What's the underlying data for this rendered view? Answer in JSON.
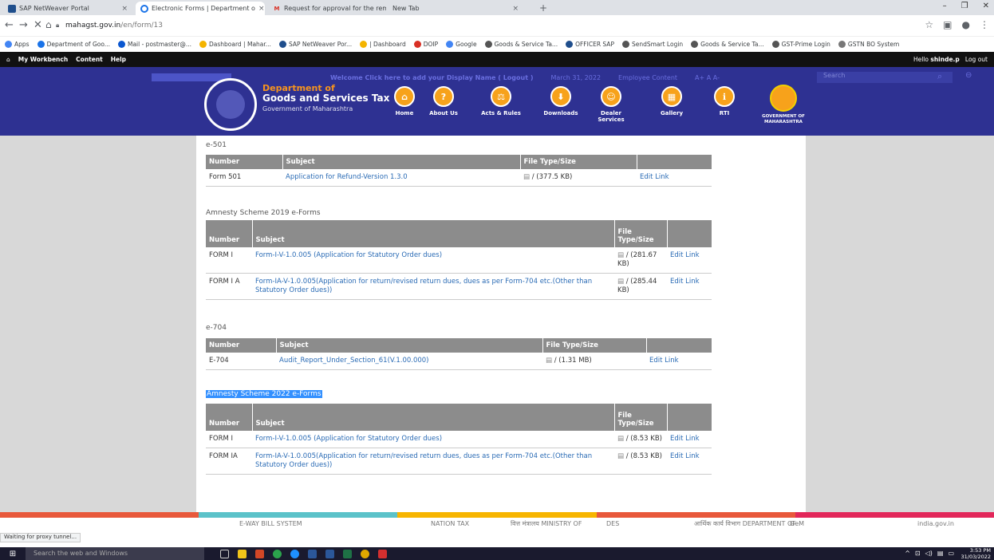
{
  "browser": {
    "tabs": [
      {
        "title": "SAP NetWeaver Portal",
        "color": "#1f4e8c",
        "active": false
      },
      {
        "title": "Electronic Forms | Department o",
        "color": "#1a73e8",
        "active": true
      },
      {
        "title": "Request for approval for the rem",
        "color": "#d93025",
        "active": false
      },
      {
        "title": "New Tab",
        "color": "#ffffff",
        "active": false
      }
    ],
    "url_host": "mahagst.gov.in",
    "url_path": "/en/form/13",
    "bookmarks": [
      "Apps",
      "Department of Goo...",
      "Mail - postmaster@...",
      "Dashboard | Mahar...",
      "SAP NetWeaver Por...",
      "| Dashboard",
      "DOIP",
      "Google",
      "Goods & Service Ta...",
      "OFFICER SAP",
      "SendSmart Login",
      "Goods & Service Ta...",
      "GST-Prime Login",
      "GSTN BO System"
    ]
  },
  "workbench": {
    "items": [
      "My Workbench",
      "Content",
      "Help"
    ],
    "hello_prefix": "Hello",
    "user": "shinde.p",
    "logout": "Log out"
  },
  "site": {
    "welcome_text": "Welcome  Click here  to add your Display Name ( Logout )",
    "date_text": "March 31, 2022",
    "employee_content": "Employee Content",
    "font_ctrl": "A+  A  A-",
    "search_label": "Search",
    "dept_line1": "Department of",
    "dept_line2": "Goods and Services Tax",
    "dept_line3": "Government of Maharashtra",
    "nav": [
      "Home",
      "About Us",
      "Acts & Rules",
      "Downloads",
      "Dealer Services",
      "Gallery",
      "RTI"
    ],
    "gom_line1": "GOVERNMENT OF",
    "gom_line2": "MAHARASHTRA",
    "accent": "#f7a21b",
    "header_bg": "#2e3192"
  },
  "sections": [
    {
      "title": "e-501",
      "headers": [
        "Number",
        "Subject",
        "File Type/Size",
        ""
      ],
      "rows": [
        {
          "number": "Form 501",
          "subject": "Application for Refund-Version 1.3.0",
          "file": "/ (377.5 KB)",
          "edit": "Edit Link"
        }
      ]
    },
    {
      "title": "Amnesty Scheme 2019 e-Forms",
      "headers": [
        "Number",
        "Subject",
        "File Type/Size",
        ""
      ],
      "rows": [
        {
          "number": "FORM I",
          "subject": "Form-I-V-1.0.005 (Application for Statutory Order dues)",
          "file": "/ (281.67 KB)",
          "edit": "Edit Link"
        },
        {
          "number": "FORM I A",
          "subject": "Form-IA-V-1.0.005(Application for return/revised return dues, dues as per Form-704 etc.(Other than Statutory Order dues))",
          "file": "/ (285.44 KB)",
          "edit": "Edit Link"
        }
      ]
    },
    {
      "title": "e-704",
      "headers": [
        "Number",
        "Subject",
        "File Type/Size",
        ""
      ],
      "rows": [
        {
          "number": "E-704",
          "subject": "Audit_Report_Under_Section_61(V.1.00.000)",
          "file": "/ (1.31 MB)",
          "edit": "Edit Link"
        }
      ]
    },
    {
      "title": "Amnesty Scheme 2022 e-Forms",
      "headers": [
        "Number",
        "Subject",
        "File Type/Size",
        ""
      ],
      "rows": [
        {
          "number": "FORM I",
          "subject": "Form-I-V-1.0.005 (Application for Statutory Order dues)",
          "file": "/ (8.53 KB)",
          "edit": "Edit Link"
        },
        {
          "number": "FORM IA",
          "subject": "Form-IA-V-1.0.005(Application for return/revised return dues, dues as per Form-704 etc.(Other than Statutory Order dues))",
          "file": "/ (8.53 KB)",
          "edit": "Edit Link"
        }
      ]
    }
  ],
  "footer": {
    "logos": [
      "E-WAY BILL SYSTEM",
      "NATION TAX",
      "वित्त मंत्रालय MINISTRY OF",
      "DES",
      "आर्थिक कार्य विभाग DEPARTMENT OF",
      "GeM",
      "india.gov.in"
    ],
    "status": "Waiting for proxy tunnel...",
    "colors": [
      "#e8583b",
      "#5bc2c9",
      "#f7b500",
      "#e8583b",
      "#e2275a"
    ]
  },
  "taskbar": {
    "search_placeholder": "Search the web and Windows",
    "time": "3:53 PM",
    "date": "31/03/2022"
  }
}
